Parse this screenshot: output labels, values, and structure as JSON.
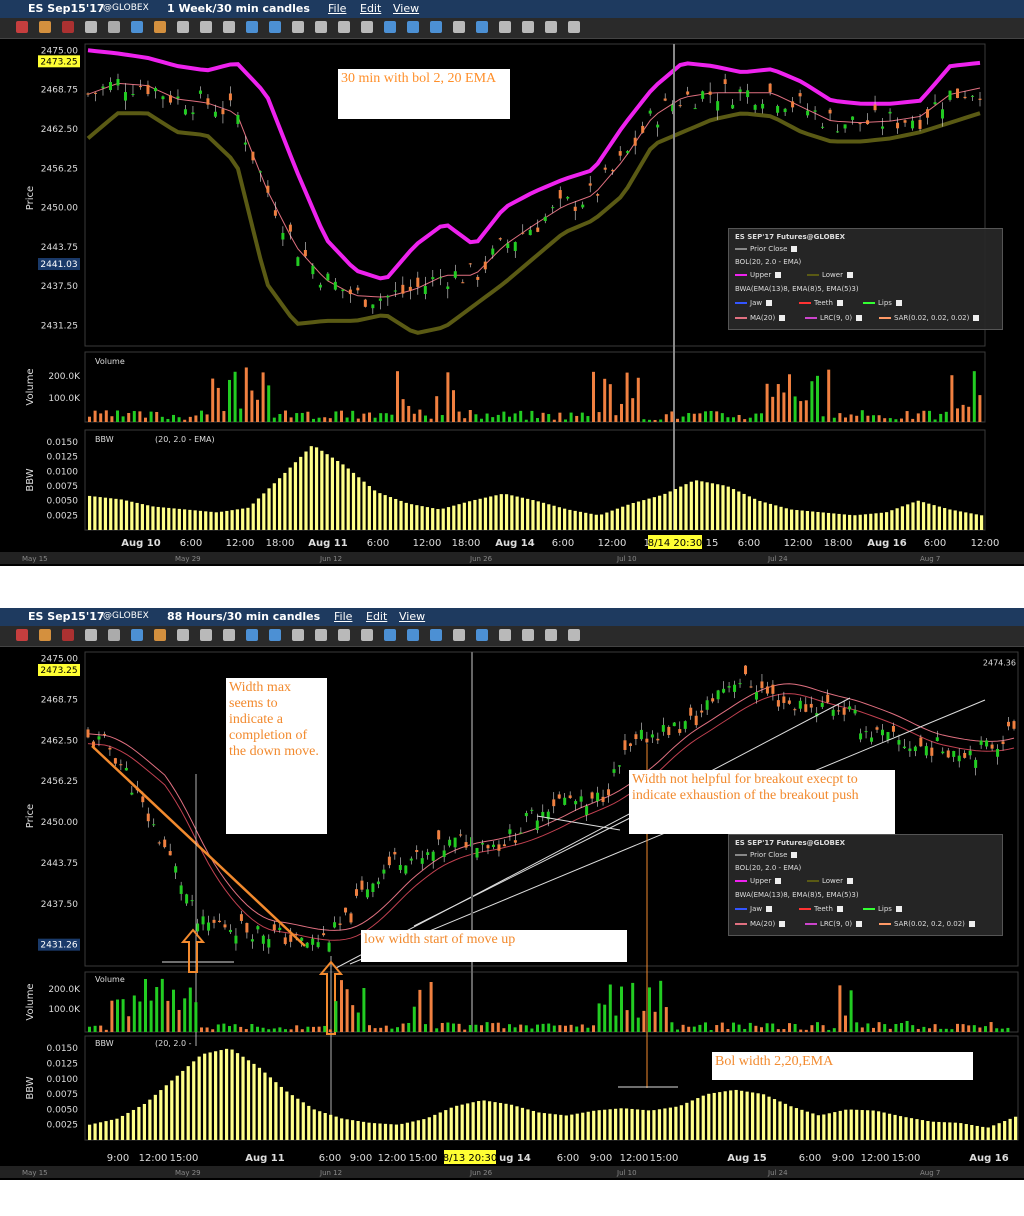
{
  "top_window": {
    "title": "ES Sep15'17",
    "exchange": "@GLOBEX",
    "timeframe": "1 Week/30 min candles",
    "menus": [
      "File",
      "Edit",
      "View"
    ],
    "annotation": "30 min with bol 2, 20 EMA",
    "price_label": "Price",
    "volume_label": "Volume",
    "bbw_label": "BBW",
    "price_ticks": [
      "2475.00",
      "2468.75",
      "2462.50",
      "2456.25",
      "2450.00",
      "2443.75",
      "2437.50",
      "2431.25"
    ],
    "price_current": "2473.25",
    "price_marker": "2441.03",
    "volume_ticks": [
      "200.0K",
      "100.0K"
    ],
    "bbw_ticks": [
      "0.0150",
      "0.0125",
      "0.0100",
      "0.0075",
      "0.0050",
      "0.0025"
    ],
    "time_ticks": [
      "Aug 10",
      "6:00",
      "12:00",
      "18:00",
      "Aug 11",
      "6:00",
      "12:00",
      "18:00",
      "Aug 14",
      "6:00",
      "12:00",
      "18",
      "15",
      "6:00",
      "12:00",
      "18:00",
      "Aug 16",
      "6:00",
      "12:00"
    ],
    "crosshair_time": "8/14 20:30",
    "nav_ticks": [
      "May 15",
      "May 29",
      "Jun 12",
      "Jun 26",
      "Jul 10",
      "Jul 24",
      "Aug 7"
    ],
    "volume_panel_title": "Volume",
    "bbw_panel_title": "BBW",
    "bbw_legend": "(20, 2.0 - EMA)"
  },
  "bottom_window": {
    "title": "ES Sep15'17",
    "exchange": "@GLOBEX",
    "timeframe": "88 Hours/30 min candles",
    "menus": [
      "File",
      "Edit",
      "View"
    ],
    "annotation_width_max": "Width max seems to indicate a completion of the down move.",
    "annotation_low_width": "low width start of move up",
    "annotation_breakout": "Width not helpful for breakout execpt to indicate exhaustion of the breakout push",
    "annotation_bol": "Bol width 2,20,EMA",
    "price_label": "Price",
    "volume_label": "Volume",
    "bbw_label": "BBW",
    "price_ticks": [
      "2475.00",
      "2468.75",
      "2462.50",
      "2456.25",
      "2450.00",
      "2443.75",
      "2437.50"
    ],
    "price_current": "2473.25",
    "price_marker": "2431.26",
    "price_right_label": "2474.36",
    "volume_ticks": [
      "200.0K",
      "100.0K"
    ],
    "bbw_ticks": [
      "0.0150",
      "0.0125",
      "0.0100",
      "0.0075",
      "0.0050",
      "0.0025"
    ],
    "time_ticks": [
      "9:00",
      "12:00",
      "15:00",
      "Aug 11",
      "6:00",
      "9:00",
      "12:00",
      "15:00",
      "ug 14",
      "6:00",
      "9:00",
      "12:00",
      "15:00",
      "Aug 15",
      "6:00",
      "9:00",
      "12:00",
      "15:00",
      "Aug 16"
    ],
    "crosshair_time": "8/13 20:30",
    "nav_ticks": [
      "May 15",
      "May 29",
      "Jun 12",
      "Jun 26",
      "Jul 10",
      "Jul 24",
      "Aug 7"
    ],
    "volume_panel_title": "Volume",
    "bbw_panel_title": "BBW",
    "bbw_legend": "(20, 2.0 -"
  },
  "legend": {
    "title": "ES SEP'17 Futures@GLOBEX",
    "prior_close": "Prior Close",
    "bol": "BOL(20, 2.0 - EMA)",
    "upper": "Upper",
    "lower": "Lower",
    "bwa": "BWA(EMA(13)8, EMA(8)5, EMA(5)3)",
    "jaw": "Jaw",
    "teeth": "Teeth",
    "lips": "Lips",
    "ma": "MA(20)",
    "lrc": "LRC(9, 0)",
    "sar_top": "SAR(0.02, 0.02, 0.02)",
    "sar_bottom": "SAR(0.02, 0.2, 0.02)"
  },
  "colors": {
    "upper_band": "#ee22ee",
    "lower_band": "#5a5a14",
    "ma_line": "#e07080",
    "up_candle": "#22cc22",
    "down_candle": "#f08040",
    "bbw_bar": "#ffff88",
    "current_price": "#ffff33",
    "titlebar": "#1e3a5f"
  },
  "chart_data": [
    {
      "type": "candlestick",
      "panel": "top",
      "title": "",
      "ylabel": "Price",
      "ylim": [
        2428,
        2476
      ],
      "series": [
        {
          "name": "Upper",
          "values": [
            2475.0,
            2474.5,
            2473.8,
            2472.5,
            2471.8,
            2473.0,
            2468.0,
            2456.0,
            2445.0,
            2440.0,
            2438.5,
            2444.0,
            2447.5,
            2444.0,
            2450.0,
            2452.5,
            2454.5,
            2456.0,
            2463.0,
            2469.0,
            2473.0,
            2472.5,
            2471.5,
            2472.0,
            2470.0,
            2467.0,
            2466.5,
            2466.5,
            2467.0,
            2472.5,
            2473.0
          ]
        },
        {
          "name": "Lower",
          "values": [
            2461.0,
            2465.0,
            2465.0,
            2462.0,
            2461.5,
            2457.0,
            2438.0,
            2431.5,
            2432.0,
            2432.0,
            2433.0,
            2430.0,
            2431.0,
            2434.5,
            2438.0,
            2442.0,
            2446.0,
            2448.0,
            2452.0,
            2460.0,
            2462.0,
            2464.0,
            2465.0,
            2464.5,
            2462.0,
            2460.5,
            2460.5,
            2461.0,
            2462.0,
            2463.5,
            2465.0
          ]
        }
      ]
    },
    {
      "type": "bar",
      "panel": "top-bbw",
      "ylabel": "BBW",
      "ylim": [
        0,
        0.016
      ],
      "values": [
        0.0058,
        0.0052,
        0.004,
        0.0035,
        0.003,
        0.0038,
        0.009,
        0.0145,
        0.011,
        0.0065,
        0.0045,
        0.0035,
        0.005,
        0.0062,
        0.005,
        0.0035,
        0.0025,
        0.0045,
        0.006,
        0.0085,
        0.0075,
        0.005,
        0.0035,
        0.003,
        0.0025,
        0.003,
        0.005,
        0.0035,
        0.0025
      ]
    },
    {
      "type": "bar",
      "panel": "bottom-bbw",
      "ylabel": "BBW",
      "ylim": [
        0,
        0.016
      ],
      "values": [
        0.0025,
        0.0035,
        0.006,
        0.01,
        0.014,
        0.015,
        0.012,
        0.008,
        0.005,
        0.0035,
        0.0028,
        0.0025,
        0.0035,
        0.0055,
        0.0065,
        0.0058,
        0.0045,
        0.004,
        0.0048,
        0.0052,
        0.0048,
        0.0055,
        0.0075,
        0.0082,
        0.0075,
        0.0055,
        0.004,
        0.005,
        0.0048,
        0.0038,
        0.003,
        0.0028,
        0.002,
        0.0038
      ]
    }
  ]
}
